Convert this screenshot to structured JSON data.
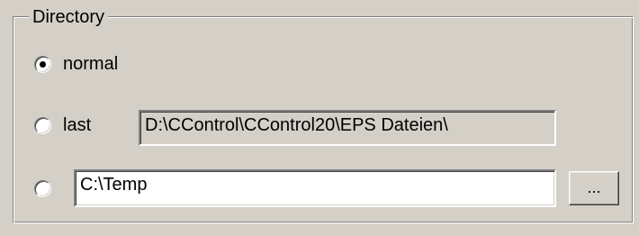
{
  "group": {
    "title": "Directory"
  },
  "options": {
    "normal": {
      "label": "normal",
      "selected": true
    },
    "last": {
      "label": "last",
      "selected": false,
      "path": "D:\\CControl\\CControl20\\EPS Dateien\\"
    },
    "custom": {
      "selected": false,
      "path": "C:\\Temp"
    }
  },
  "browse_button": {
    "label": "..."
  }
}
